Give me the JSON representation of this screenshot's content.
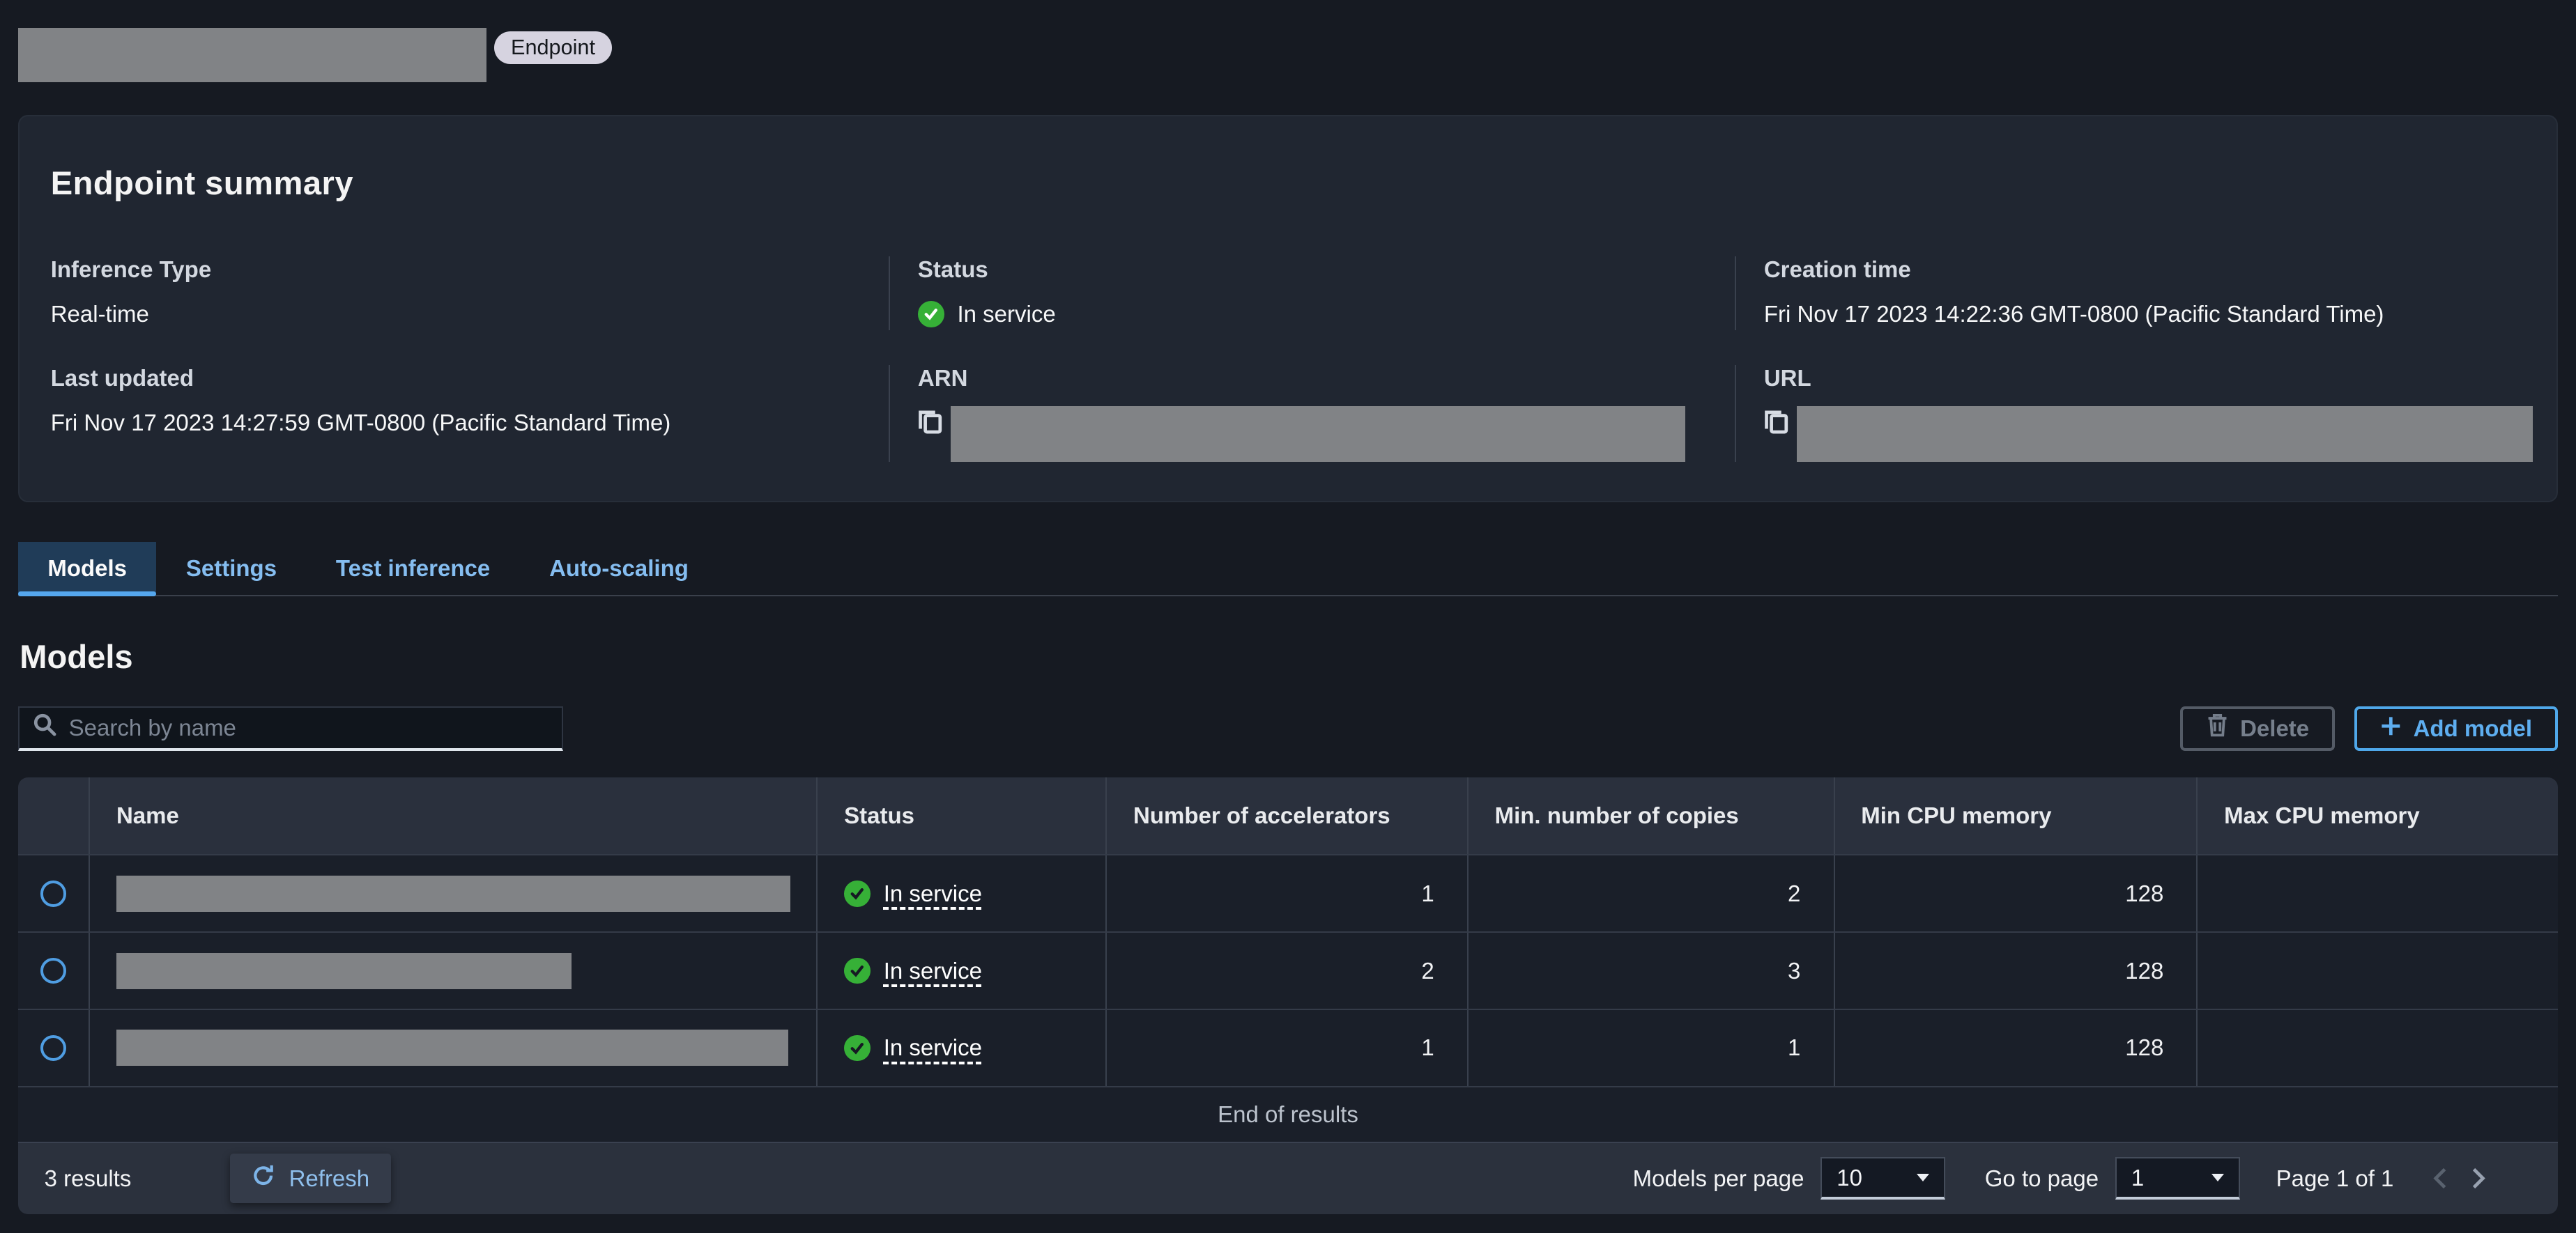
{
  "header": {
    "endpoint_badge": "Endpoint"
  },
  "summary": {
    "title": "Endpoint summary",
    "fields": [
      {
        "label": "Inference Type",
        "value": "Real-time"
      },
      {
        "label": "Status",
        "value": "In service"
      },
      {
        "label": "Creation time",
        "value": "Fri Nov 17 2023 14:22:36 GMT-0800 (Pacific Standard Time)"
      },
      {
        "label": "Last updated",
        "value": "Fri Nov 17 2023 14:27:59 GMT-0800 (Pacific Standard Time)"
      },
      {
        "label": "ARN",
        "value": ""
      },
      {
        "label": "URL",
        "value": ""
      }
    ]
  },
  "tabs": [
    {
      "label": "Models",
      "active": true
    },
    {
      "label": "Settings",
      "active": false
    },
    {
      "label": "Test inference",
      "active": false
    },
    {
      "label": "Auto-scaling",
      "active": false
    }
  ],
  "models": {
    "heading": "Models",
    "search_placeholder": "Search by name",
    "delete_label": "Delete",
    "add_label": "Add model",
    "table": {
      "columns": [
        "Name",
        "Status",
        "Number of accelerators",
        "Min. number of copies",
        "Min CPU memory",
        "Max CPU memory"
      ],
      "rows": [
        {
          "status": "In service",
          "accelerators": "1",
          "min_copies": "2",
          "min_cpu": "128",
          "max_cpu": ""
        },
        {
          "status": "In service",
          "accelerators": "2",
          "min_copies": "3",
          "min_cpu": "128",
          "max_cpu": ""
        },
        {
          "status": "In service",
          "accelerators": "1",
          "min_copies": "1",
          "min_cpu": "128",
          "max_cpu": ""
        }
      ],
      "end_text": "End of results"
    },
    "footer": {
      "results": "3 results",
      "refresh": "Refresh",
      "per_page_label": "Models per page",
      "per_page_value": "10",
      "goto_label": "Go to page",
      "goto_value": "1",
      "page_info": "Page 1 of 1"
    }
  },
  "colors": {
    "page_bg": "#161A22",
    "card_bg": "#202631",
    "accent_blue": "#539fe5",
    "success_green": "#36b037",
    "redaction_gray": "#818386"
  }
}
